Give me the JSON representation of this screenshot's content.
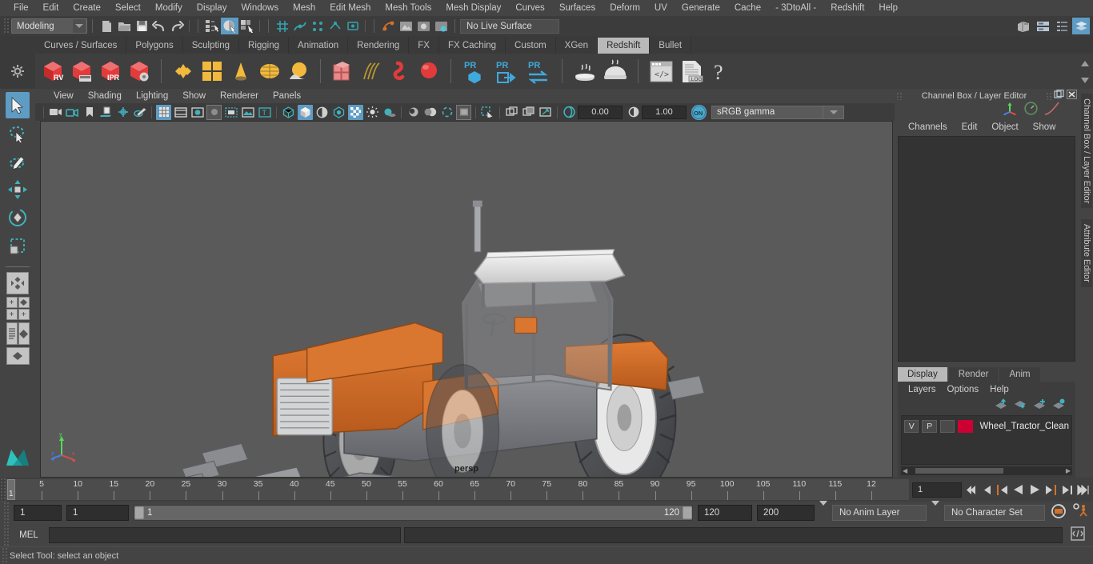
{
  "menubar": {
    "items": [
      "File",
      "Edit",
      "Create",
      "Select",
      "Modify",
      "Display",
      "Windows",
      "Mesh",
      "Edit Mesh",
      "Mesh Tools",
      "Mesh Display",
      "Curves",
      "Surfaces",
      "Deform",
      "UV",
      "Generate",
      "Cache",
      "- 3DtoAll -",
      "Redshift",
      "Help"
    ]
  },
  "statusline": {
    "mode": "Modeling",
    "live_surface": "No Live Surface",
    "icons": [
      "new-scene-icon",
      "open-scene-icon",
      "save-scene-icon",
      "undo-icon",
      "redo-icon",
      "select-by-hierarchy-icon",
      "select-by-object-icon",
      "select-by-component-icon",
      "snap-grid-icon",
      "snap-curve-icon",
      "snap-point-icon",
      "snap-projected-icon",
      "snap-view-icon",
      "construction-history-icon",
      "render-current-frame-icon",
      "ipr-render-icon",
      "render-settings-icon",
      "outliner-icon",
      "node-editor-icon",
      "hypershade-icon",
      "attribute-editor-icon"
    ]
  },
  "shelf": {
    "tabs": [
      "Curves / Surfaces",
      "Polygons",
      "Sculpting",
      "Rigging",
      "Animation",
      "Rendering",
      "FX",
      "FX Caching",
      "Custom",
      "XGen",
      "Redshift",
      "Bullet"
    ],
    "active_tab": "Redshift",
    "buttons": [
      {
        "name": "redshift-rv-icon",
        "label": "RV"
      },
      {
        "name": "redshift-render-sequence-icon",
        "label": ""
      },
      {
        "name": "redshift-ipr-icon",
        "label": "IPR"
      },
      {
        "name": "redshift-render-settings-icon",
        "label": ""
      },
      {
        "name": "redshift-material-icon",
        "label": ""
      },
      {
        "name": "redshift-texture-icon",
        "label": ""
      },
      {
        "name": "redshift-light-cone-icon",
        "label": ""
      },
      {
        "name": "redshift-dome-light-icon",
        "label": ""
      },
      {
        "name": "redshift-environment-icon",
        "label": ""
      },
      {
        "name": "redshift-proxy-icon",
        "label": ""
      },
      {
        "name": "redshift-hair-icon",
        "label": ""
      },
      {
        "name": "redshift-volume-icon",
        "label": ""
      },
      {
        "name": "redshift-sphere-icon",
        "label": ""
      },
      {
        "name": "redshift-pr-object-icon",
        "label": "PR"
      },
      {
        "name": "redshift-pr-export-icon",
        "label": "PR"
      },
      {
        "name": "redshift-pr-transfer-icon",
        "label": "PR"
      },
      {
        "name": "redshift-bake-icon",
        "label": ""
      },
      {
        "name": "redshift-bake-set-icon",
        "label": ""
      },
      {
        "name": "redshift-script-icon",
        "label": ""
      },
      {
        "name": "redshift-log-icon",
        "label": ".LOG"
      },
      {
        "name": "redshift-help-icon",
        "label": "?"
      }
    ]
  },
  "toolbox": {
    "tools": [
      "select-tool",
      "lasso-select-tool",
      "paint-select-tool",
      "move-tool",
      "rotate-tool",
      "scale-tool",
      "last-tool-used"
    ],
    "layouts": [
      "single-perspective-layout",
      "four-view-layout",
      "outliner-persp-layout",
      "hypershade-persp-layout",
      "maya-logo"
    ]
  },
  "viewport": {
    "menus": [
      "View",
      "Shading",
      "Lighting",
      "Show",
      "Renderer",
      "Panels"
    ],
    "exposure": "0.00",
    "gamma": "1.00",
    "color_management": "sRGB gamma",
    "camera_label": "persp",
    "axis_labels": {
      "x": "x",
      "y": "y",
      "z": "z"
    },
    "scene_object": "Tractor model"
  },
  "right_panel": {
    "title": "Channel Box / Layer Editor",
    "menus": [
      "Channels",
      "Edit",
      "Object",
      "Show"
    ],
    "layer_tabs": [
      "Display",
      "Render",
      "Anim"
    ],
    "active_layer_tab": "Display",
    "layer_menus": [
      "Layers",
      "Options",
      "Help"
    ],
    "layers": [
      {
        "visibility": "V",
        "playback": "P",
        "type": "",
        "color": "#cc0033",
        "name": "Wheel_Tractor_Clean"
      }
    ],
    "vertical_tabs": [
      "Channel Box / Layer Editor",
      "Attribute Editor"
    ]
  },
  "timeline": {
    "tick_labels": [
      "5",
      "10",
      "15",
      "20",
      "25",
      "30",
      "35",
      "40",
      "45",
      "50",
      "55",
      "60",
      "65",
      "70",
      "75",
      "80",
      "85",
      "90",
      "95",
      "100",
      "105",
      "110",
      "115",
      "12"
    ],
    "current_frame_marker": "1",
    "current_frame_field": "1",
    "playback_buttons": [
      "go-to-start-icon",
      "step-back-keyframe-icon",
      "step-back-frame-icon",
      "play-backwards-icon",
      "play-forwards-icon",
      "step-forward-frame-icon",
      "step-forward-keyframe-icon",
      "go-to-end-icon"
    ]
  },
  "range": {
    "anim_start": "1",
    "range_start": "1",
    "slider_start_label": "1",
    "slider_end_label": "120",
    "range_end": "120",
    "anim_end": "200",
    "anim_layer": "No Anim Layer",
    "character_set": "No Character Set",
    "auto_key_icon": "auto-keyframe-icon",
    "prefs_icon": "animation-preferences-icon"
  },
  "command": {
    "label": "MEL",
    "input_value": "",
    "result_value": "",
    "script-editor-icon": "script-editor-icon"
  },
  "status": {
    "message": "Select Tool: select an object"
  },
  "colors": {
    "accent_blue": "#5e9cc4",
    "shelf_bg": "#3f3f3f",
    "panel_bg": "#444444",
    "viewport_bg": "#5a5a5a",
    "layer_color": "#cc0033",
    "orange": "#d4722a"
  }
}
